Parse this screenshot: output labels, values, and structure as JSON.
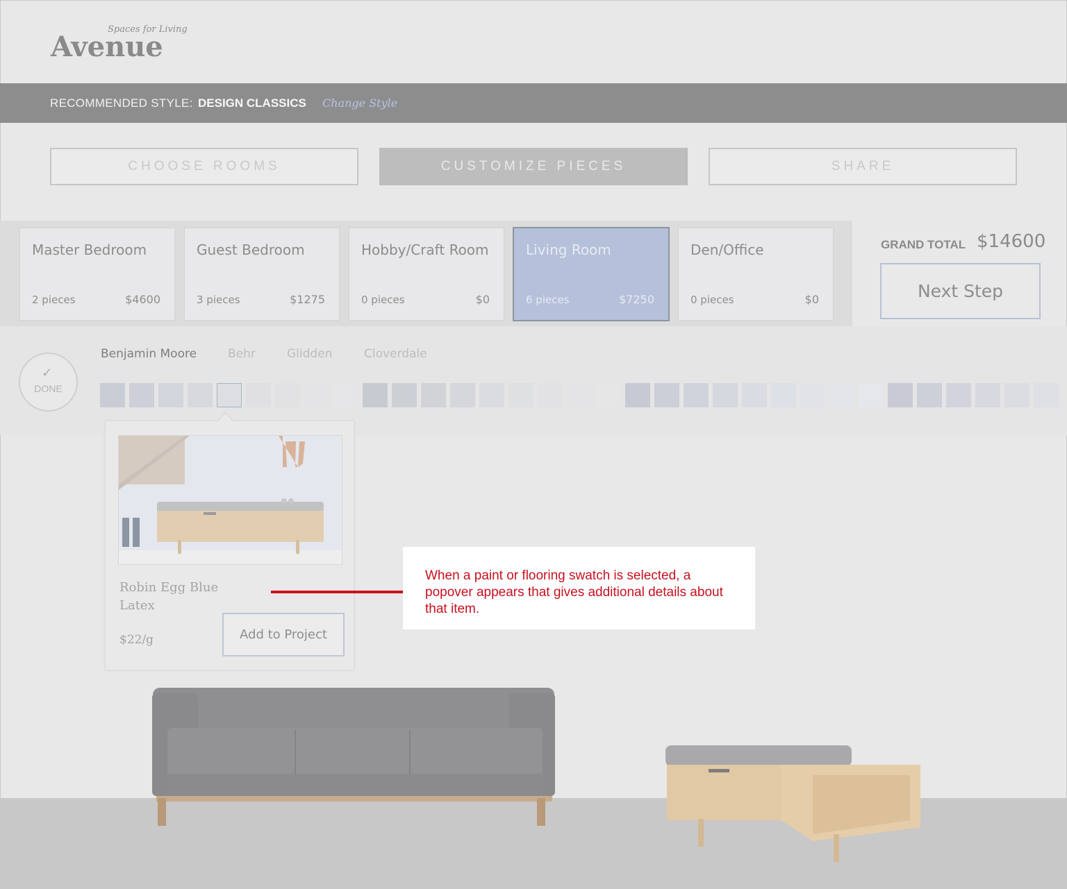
{
  "brand": {
    "name": "Avenue",
    "tagline": "Spaces for Living"
  },
  "style_bar": {
    "label": "RECOMMENDED STYLE:",
    "value": "DESIGN CLASSICS",
    "change_link": "Change Style"
  },
  "steps": [
    {
      "label": "CHOOSE ROOMS",
      "active": false
    },
    {
      "label": "CUSTOMIZE PIECES",
      "active": true
    },
    {
      "label": "SHARE",
      "active": false
    }
  ],
  "rooms": [
    {
      "name": "Master Bedroom",
      "pieces": "2 pieces",
      "price": "$4600",
      "active": false
    },
    {
      "name": "Guest Bedroom",
      "pieces": "3 pieces",
      "price": "$1275",
      "active": false
    },
    {
      "name": "Hobby/Craft Room",
      "pieces": "0 pieces",
      "price": "$0",
      "active": false
    },
    {
      "name": "Living Room",
      "pieces": "6 pieces",
      "price": "$7250",
      "active": true
    },
    {
      "name": "Den/Office",
      "pieces": "0 pieces",
      "price": "$0",
      "active": false
    }
  ],
  "grand_total": {
    "label": "GRAND TOTAL",
    "value": "$14600"
  },
  "next_step": "Next Step",
  "done_button": {
    "icon": "check-icon",
    "label": "DONE"
  },
  "paint_brands": [
    {
      "name": "Benjamin Moore",
      "active": true
    },
    {
      "name": "Behr",
      "active": false
    },
    {
      "name": "Glidden",
      "active": false
    },
    {
      "name": "Cloverdale",
      "active": false
    }
  ],
  "swatch_colors": [
    "#c8ccd5",
    "#cdd0d8",
    "#d2d5dc",
    "#d7d9df",
    "#dddee2",
    "#e0e0e3",
    "#e2e2e5",
    "#e4e4e6",
    "#e6e6e8",
    "#c7cbd1",
    "#cccfd4",
    "#d1d3d7",
    "#d6d7da",
    "#dbdcdf",
    "#dfe0e2",
    "#e2e2e4",
    "#e4e4e6",
    "#e6e6e7",
    "#c5cad4",
    "#cacfd8",
    "#cfd3dc",
    "#d4d8df",
    "#d9dce3",
    "#dde0e6",
    "#e1e3e8",
    "#e4e5ea",
    "#e6e7eb",
    "#c9cad6",
    "#cdcfd9",
    "#d2d3dc",
    "#d7d8e0",
    "#dcdce3",
    "#dfe0e5"
  ],
  "selected_swatch_index": 4,
  "popover": {
    "name": "Robin Egg Blue Latex",
    "price": "$22/g",
    "add_button": "Add to Project"
  },
  "annotation": {
    "text": "When a paint or flooring swatch is selected, a popover appears that gives additional details about that item.",
    "color": "#c8101f"
  },
  "colors": {
    "active_room": "#b5c0da",
    "style_bar": "#8e8d8e",
    "sofa": "#8f8f91",
    "wood": "#e2c9a5"
  }
}
